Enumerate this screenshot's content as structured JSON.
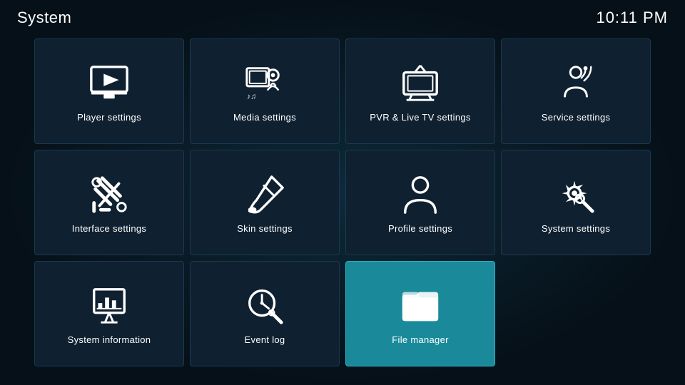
{
  "header": {
    "title": "System",
    "time": "10:11 PM"
  },
  "tiles": [
    {
      "id": "player-settings",
      "label": "Player settings",
      "icon": "monitor-play",
      "active": false
    },
    {
      "id": "media-settings",
      "label": "Media settings",
      "icon": "media",
      "active": false
    },
    {
      "id": "pvr-settings",
      "label": "PVR & Live TV settings",
      "icon": "tv",
      "active": false
    },
    {
      "id": "service-settings",
      "label": "Service settings",
      "icon": "wifi-person",
      "active": false
    },
    {
      "id": "interface-settings",
      "label": "Interface settings",
      "icon": "interface",
      "active": false
    },
    {
      "id": "skin-settings",
      "label": "Skin settings",
      "icon": "paintbrush",
      "active": false
    },
    {
      "id": "profile-settings",
      "label": "Profile settings",
      "icon": "person",
      "active": false
    },
    {
      "id": "system-settings",
      "label": "System settings",
      "icon": "gear-wrench",
      "active": false
    },
    {
      "id": "system-information",
      "label": "System information",
      "icon": "chart-board",
      "active": false
    },
    {
      "id": "event-log",
      "label": "Event log",
      "icon": "clock-search",
      "active": false
    },
    {
      "id": "file-manager",
      "label": "File manager",
      "icon": "folder",
      "active": true
    }
  ]
}
